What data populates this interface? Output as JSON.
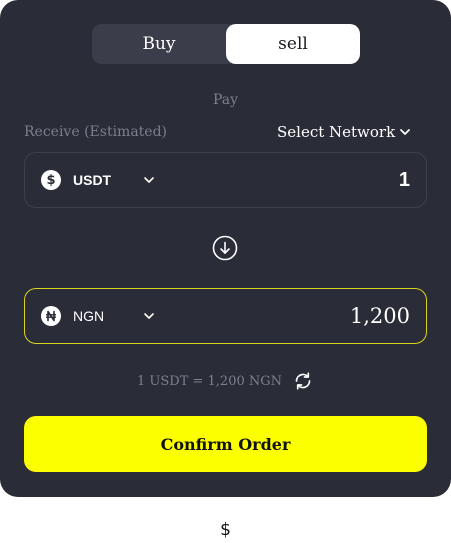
{
  "mode_toggle": {
    "buy_label": "Buy",
    "sell_label": "sell",
    "active": "sell"
  },
  "labels": {
    "pay": "Pay",
    "receive": "Receive (Estimated)",
    "network": "Select Network"
  },
  "from": {
    "currency": "USDT",
    "icon": "dollar-coin-icon",
    "amount": "1"
  },
  "to": {
    "currency": "NGN",
    "icon": "naira-coin-icon",
    "amount": "1,200"
  },
  "rate": {
    "text": "1 USDT = 1,200 NGN"
  },
  "actions": {
    "confirm_label": "Confirm Order"
  },
  "footer": {
    "glyph": "$"
  },
  "colors": {
    "card": "#2a2c37",
    "accent": "#fbff00",
    "active_border": "#d8d41f",
    "muted": "#7d7f8c"
  }
}
